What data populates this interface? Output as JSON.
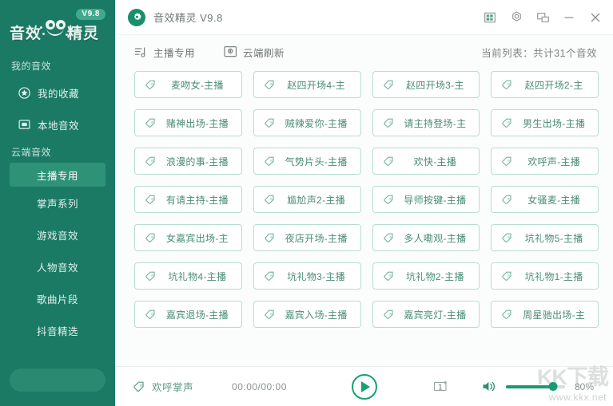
{
  "colors": {
    "sidebar_bg": "#1a7a64",
    "accent": "#2e9277",
    "button_border": "#b7ddd1",
    "button_text": "#4a8c76",
    "play_green": "#19a06e"
  },
  "sidebar": {
    "logo": {
      "text_left": "音效",
      "text_right": "精灵",
      "version_badge": "V9.8",
      "face_icon": "panda-face-icon"
    },
    "groups": [
      {
        "title": "我的音效",
        "items": [
          {
            "label": "我的收藏",
            "icon": "star-badge-icon",
            "active": false
          },
          {
            "label": "本地音效",
            "icon": "folder-media-icon",
            "active": false
          }
        ]
      },
      {
        "title": "云端音效",
        "items": [
          {
            "label": "主播专用",
            "icon": "",
            "active": true
          },
          {
            "label": "掌声系列",
            "icon": "",
            "active": false
          },
          {
            "label": "游戏音效",
            "icon": "",
            "active": false
          },
          {
            "label": "人物音效",
            "icon": "",
            "active": false
          },
          {
            "label": "歌曲片段",
            "icon": "",
            "active": false
          },
          {
            "label": "抖音精选",
            "icon": "",
            "active": false
          }
        ]
      }
    ],
    "search": {
      "placeholder": "",
      "value": "",
      "icon": "search-icon"
    }
  },
  "titlebar": {
    "app_icon": "app-logo-icon",
    "title": "音效精灵 V9.8",
    "buttons": [
      {
        "name": "skin-icon",
        "label": ""
      },
      {
        "name": "settings-gear-icon",
        "label": ""
      },
      {
        "name": "minimize-to-tray-icon",
        "label": ""
      },
      {
        "name": "minimize-icon",
        "label": ""
      },
      {
        "name": "close-icon",
        "label": ""
      }
    ]
  },
  "toolbar": {
    "items": [
      {
        "label": "主播专用",
        "icon": "playlist-music-icon"
      },
      {
        "label": "云端刷新",
        "icon": "cloud-refresh-icon"
      }
    ],
    "count_text": "当前列表：共计31个音效"
  },
  "grid": {
    "item_icon": "sound-tag-icon",
    "items": [
      "麦吻女-主播",
      "赵四开场4-主",
      "赵四开场3-主",
      "赵四开场2-主",
      "赌神出场-主播",
      "贼辣爱你-主播",
      "请主持登场-主",
      "男生出场-主播",
      "浪漫的事-主播",
      "气势片头-主播",
      "欢快-主播",
      "欢呼声-主播",
      "有请主持-主播",
      "尴尬声2-主播",
      "导师按键-主播",
      "女骚麦-主播",
      "女嘉宾出场-主",
      "夜店开场-主播",
      "多人嘞观-主播",
      "坑礼物5-主播",
      "坑礼物4-主播",
      "坑礼物3-主播",
      "坑礼物2-主播",
      "坑礼物1-主播",
      "嘉宾退场-主播",
      "嘉宾入场-主播",
      "嘉宾亮灯-主播",
      "周星驰出场-主"
    ]
  },
  "player": {
    "now_icon": "sound-tag-icon",
    "now_playing": "欢呼掌声",
    "time": "00:00/00:00",
    "play_button": "play-icon",
    "loop_button": "repeat-one-icon",
    "volume_icon": "volume-icon",
    "volume_percent": "80%",
    "volume_value": 80
  },
  "watermark": {
    "main": "KK下载",
    "sub": "www.kkx.net"
  }
}
